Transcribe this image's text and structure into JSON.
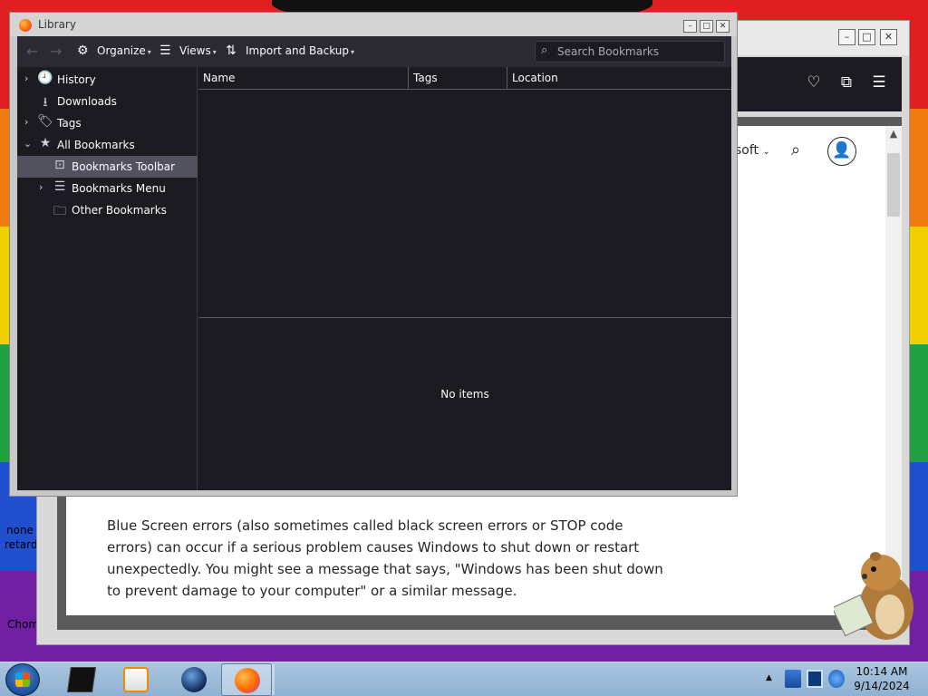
{
  "desktop": {
    "labels": [
      "none o",
      "retards",
      "Chom"
    ]
  },
  "browser": {
    "nav_partial": "soft",
    "article_text": "Blue Screen errors (also sometimes called black screen errors or STOP code errors) can occur if a serious problem causes Windows to shut down or restart unexpectedly. You might see a message that says, \"Windows has been shut down to prevent damage to your computer\" or a similar message."
  },
  "library": {
    "title": "Library",
    "toolbar": {
      "organize": "Organize",
      "views": "Views",
      "import_backup": "Import and Backup",
      "search_placeholder": "Search Bookmarks"
    },
    "tree": [
      {
        "label": "History",
        "icon": "clock-icon"
      },
      {
        "label": "Downloads",
        "icon": "download-icon"
      },
      {
        "label": "Tags",
        "icon": "tag-icon"
      },
      {
        "label": "All Bookmarks",
        "icon": "star-icon"
      },
      {
        "label": "Bookmarks Toolbar",
        "icon": "bookmarks-toolbar-icon"
      },
      {
        "label": "Bookmarks Menu",
        "icon": "bookmarks-menu-icon"
      },
      {
        "label": "Other Bookmarks",
        "icon": "folder-icon"
      }
    ],
    "columns": [
      "Name",
      "Tags",
      "Location"
    ],
    "details_text": "No items"
  },
  "taskbar": {
    "time": "10:14 AM",
    "date": "9/14/2024"
  },
  "colors": {
    "library_dark": "#1c1b22",
    "library_toolbar": "#2b2a33",
    "selection": "#52525e"
  }
}
